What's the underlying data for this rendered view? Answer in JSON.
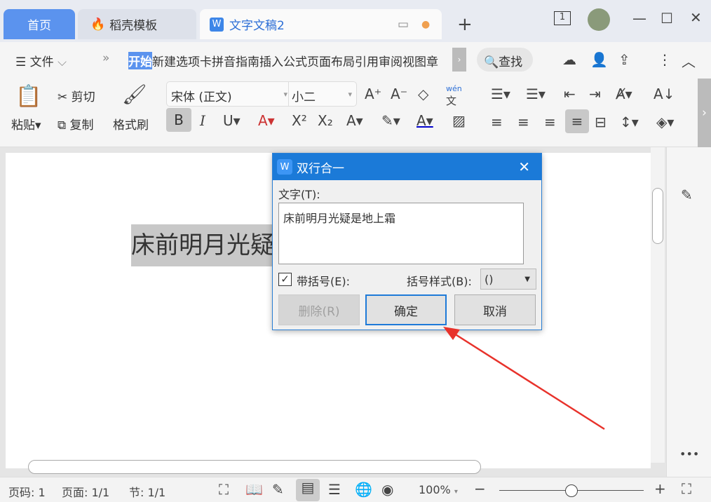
{
  "tabs": [
    {
      "label": "首页"
    },
    {
      "label": "稻壳模板"
    },
    {
      "label": "文字文稿2"
    }
  ],
  "window": {
    "badge": "1"
  },
  "toolbar": {
    "menu": "文件",
    "more": "»",
    "ribbon_tabs": [
      "开始",
      "新建选项卡",
      "拼音指南",
      "插入",
      "公式",
      "页面布局",
      "引用",
      "审阅",
      "视图",
      "章"
    ],
    "search": "查找"
  },
  "ribbon": {
    "paste": "粘贴",
    "cut": "剪切",
    "copy": "复制",
    "format_painter": "格式刷",
    "font": "宋体 (正文)",
    "size": "小二",
    "pinyin": "wén"
  },
  "document": {
    "text": "床前明月光疑"
  },
  "dialog": {
    "title": "双行合一",
    "text_label": "文字(T):",
    "text_value": "床前明月光疑是地上霜",
    "bracket_label": "带括号(E):",
    "bracket_checked": true,
    "style_label": "括号样式(B):",
    "style_value": "()",
    "delete": "删除(R)",
    "ok": "确定",
    "cancel": "取消"
  },
  "status": {
    "page_num": "页码: 1",
    "pages": "页面: 1/1",
    "section": "节: 1/1",
    "zoom": "100%",
    "zoom_level": 100
  },
  "colors": {
    "accent": "#1b7ad8",
    "arrow": "#e8322b"
  }
}
